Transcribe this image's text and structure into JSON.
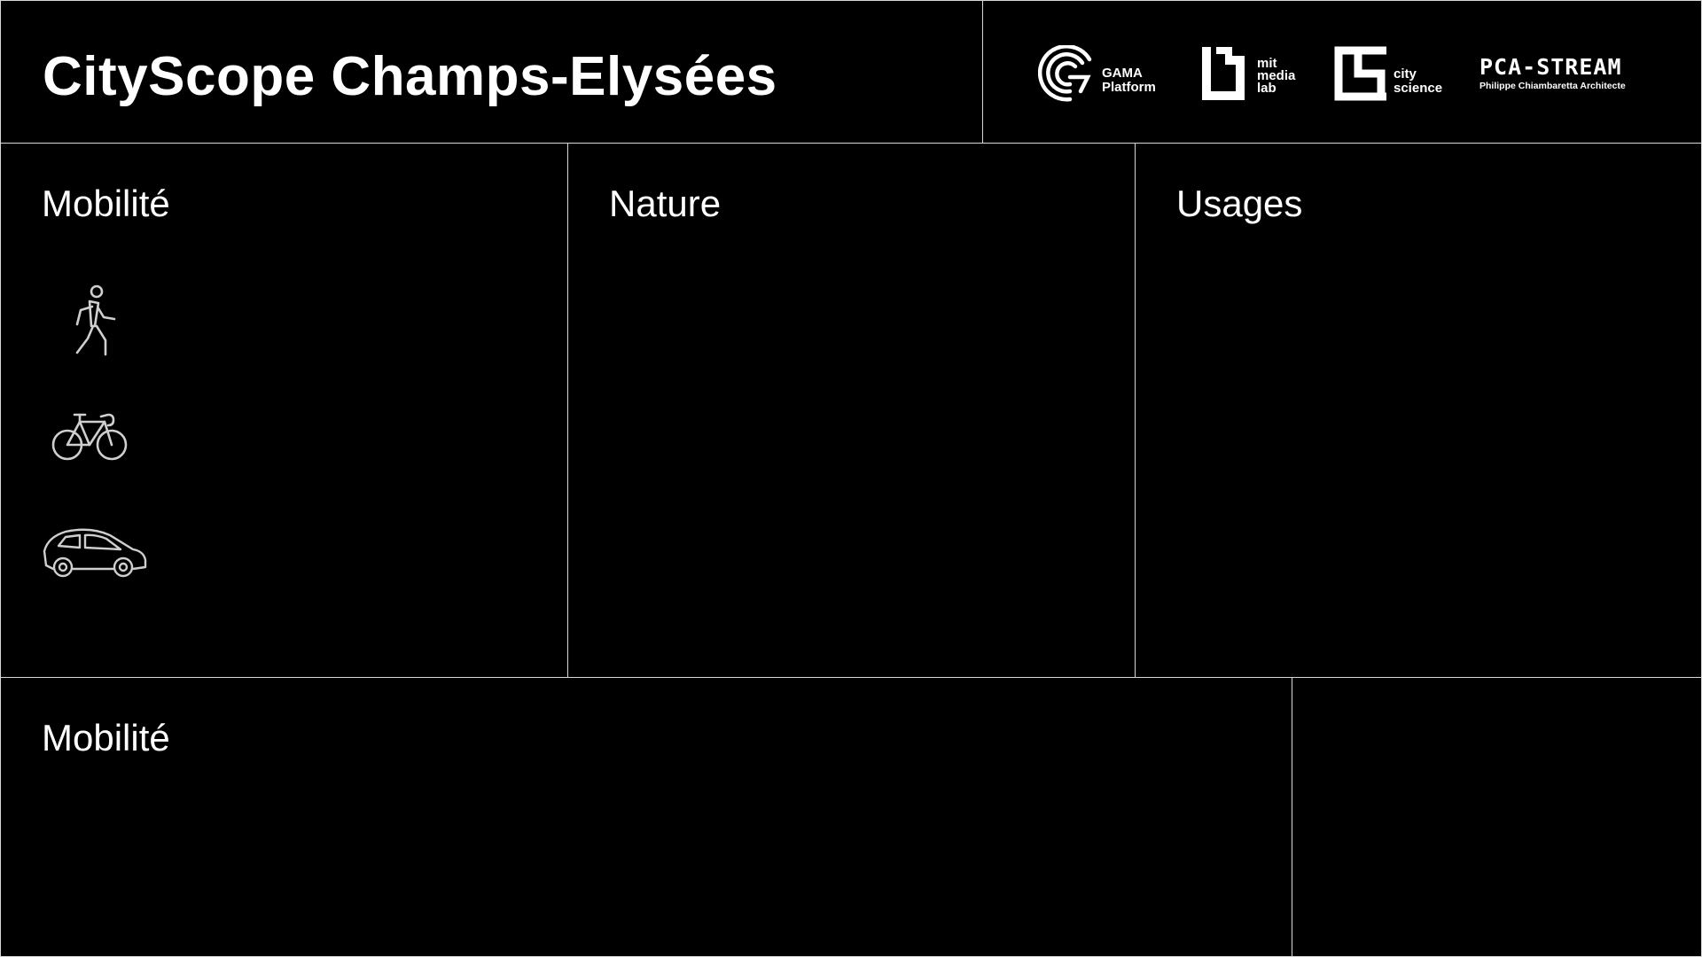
{
  "header": {
    "title": "CityScope Champs-Elysées",
    "logos": [
      {
        "name": "gama-platform",
        "lines": [
          "GAMA",
          "Platform"
        ]
      },
      {
        "name": "mit-media-lab",
        "lines": [
          "mit",
          "media",
          "lab"
        ]
      },
      {
        "name": "city-science",
        "lines": [
          "city",
          "science"
        ]
      },
      {
        "name": "pca-stream",
        "title": "PCA-STREAM",
        "subtitle": "Philippe Chiambaretta Architecte"
      }
    ]
  },
  "panels": {
    "mobilite": {
      "title": "Mobilité",
      "modes": [
        {
          "icon": "pedestrian-icon"
        },
        {
          "icon": "bicycle-icon"
        },
        {
          "icon": "car-icon"
        }
      ]
    },
    "nature": {
      "title": "Nature"
    },
    "usages": {
      "title": "Usages"
    },
    "bottom_mobilite": {
      "title": "Mobilité"
    }
  },
  "colors": {
    "background": "#000000",
    "foreground": "#ffffff",
    "border": "#d8d8d8",
    "icon_stroke": "#cfcfcf"
  }
}
